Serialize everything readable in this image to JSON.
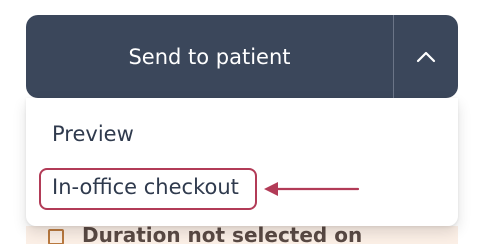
{
  "split_button": {
    "label": "Send to patient",
    "toggle_icon": "chevron-up-icon"
  },
  "menu": {
    "items": [
      {
        "label": "Preview"
      },
      {
        "label": "In-office checkout"
      }
    ]
  },
  "background_row": {
    "label": "Duration not selected on"
  },
  "colors": {
    "button_bg": "#3b475b",
    "highlight": "#b23b57",
    "menu_text": "#2f3a4d"
  }
}
